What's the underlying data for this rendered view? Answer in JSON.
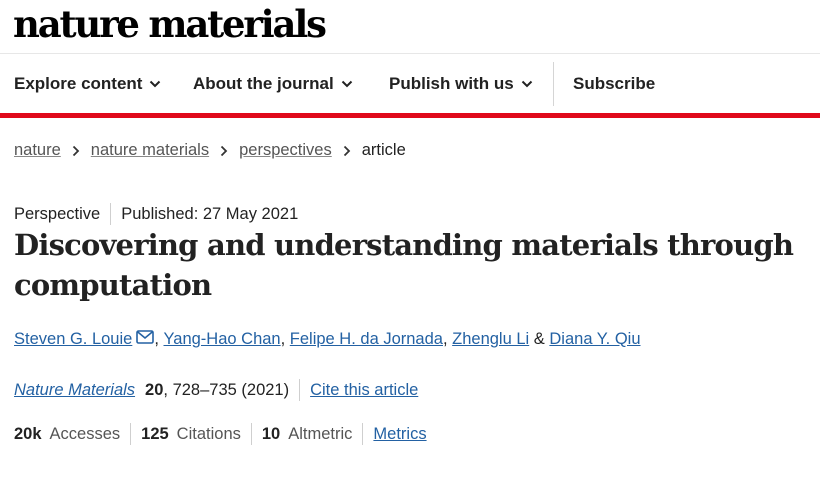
{
  "header": {
    "logo_text": "nature materials"
  },
  "nav": {
    "items": [
      {
        "label": "Explore content",
        "has_menu": true
      },
      {
        "label": "About the journal",
        "has_menu": true
      },
      {
        "label": "Publish with us",
        "has_menu": true
      }
    ],
    "subscribe_label": "Subscribe"
  },
  "breadcrumb": {
    "items": [
      "nature",
      "nature materials",
      "perspectives"
    ],
    "current": "article"
  },
  "article": {
    "type": "Perspective",
    "published": "Published: 27 May 2021",
    "title": "Discovering and understanding materials through computation",
    "authors": [
      "Steven G. Louie",
      "Yang-Hao Chan",
      "Felipe H. da Jornada",
      "Zhenglu Li",
      "Diana Y. Qiu"
    ],
    "sep_comma": ", ",
    "sep_and": " & ",
    "journal": "Nature Materials",
    "volume": "20",
    "pages_year": ", 728–735 (2021)",
    "cite_label": "Cite this article"
  },
  "metrics": {
    "accesses_value": "20k",
    "accesses_label": "Accesses",
    "citations_value": "125",
    "citations_label": "Citations",
    "altmetric_value": "10",
    "altmetric_label": "Altmetric",
    "metrics_link": "Metrics"
  },
  "colors": {
    "accent_red": "#e0091b",
    "link_blue": "#2361a3"
  },
  "icons": {
    "dropdown": "chevron-down-icon",
    "breadcrumb_sep": "chevron-right-icon",
    "email": "envelope-icon"
  }
}
